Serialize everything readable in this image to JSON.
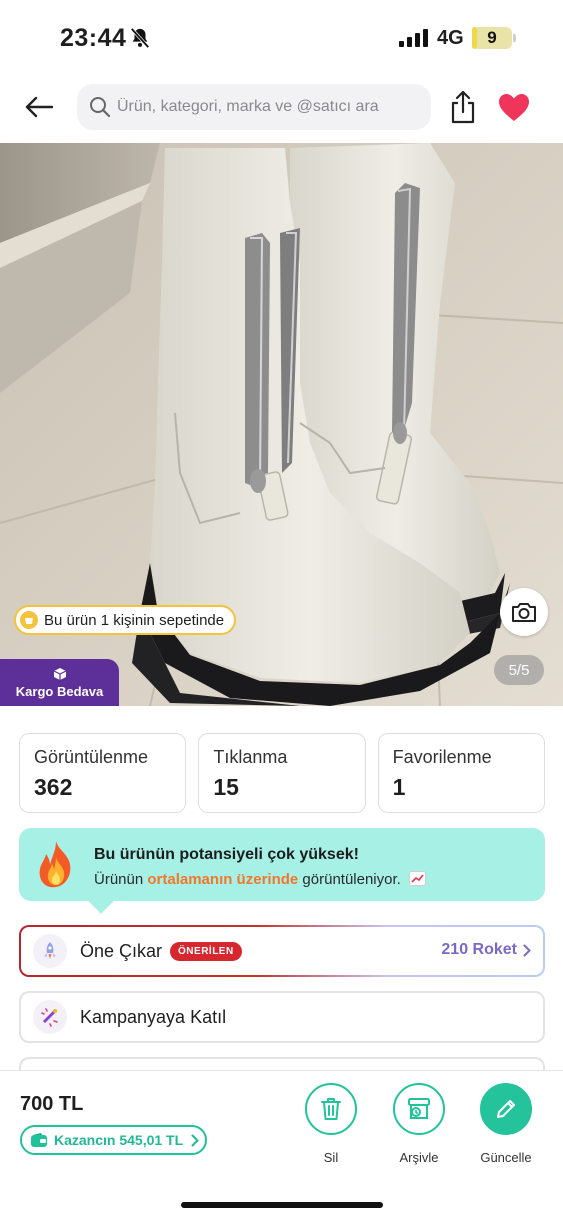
{
  "status_bar": {
    "time": "23:44",
    "network": "4G",
    "battery_level": "9",
    "battery_fraction": 0.09,
    "icons": [
      "bell-slash-icon",
      "signal-bars-icon"
    ]
  },
  "header": {
    "search_placeholder": "Ürün, kategori, marka ve @satıcı ara",
    "icons": [
      "back-arrow-icon",
      "search-icon",
      "share-icon",
      "heart-icon"
    ],
    "heart_color": "#f0355a"
  },
  "product_image": {
    "basket_notice": "Bu ürün 1 kişinin sepetinde",
    "cargo_label": "Kargo Bedava",
    "photo_counter": "5/5",
    "cargo_color": "#5d2f98"
  },
  "stats": [
    {
      "label": "Görüntülenme",
      "value": "362"
    },
    {
      "label": "Tıklanma",
      "value": "15"
    },
    {
      "label": "Favorilenme",
      "value": "1"
    }
  ],
  "potential": {
    "title": "Bu ürünün potansiyeli çok yüksek!",
    "desc_prefix": "Ürünün ",
    "desc_highlight": "ortalamanın üzerinde",
    "desc_suffix": " görüntüleniyor.",
    "background": "#a7f0e6",
    "highlight_color": "#f0782c"
  },
  "actions": {
    "feature_label": "Öne Çıkar",
    "feature_badge": "ÖNERİLEN",
    "feature_cost": "210 Roket",
    "campaign_label": "Kampanyaya Katıl"
  },
  "bottom_bar": {
    "price": "700 TL",
    "earnings": "Kazancın 545,01 TL",
    "delete_label": "Sil",
    "archive_label": "Arşivle",
    "update_label": "Güncelle",
    "accent_color": "#21c39b"
  }
}
